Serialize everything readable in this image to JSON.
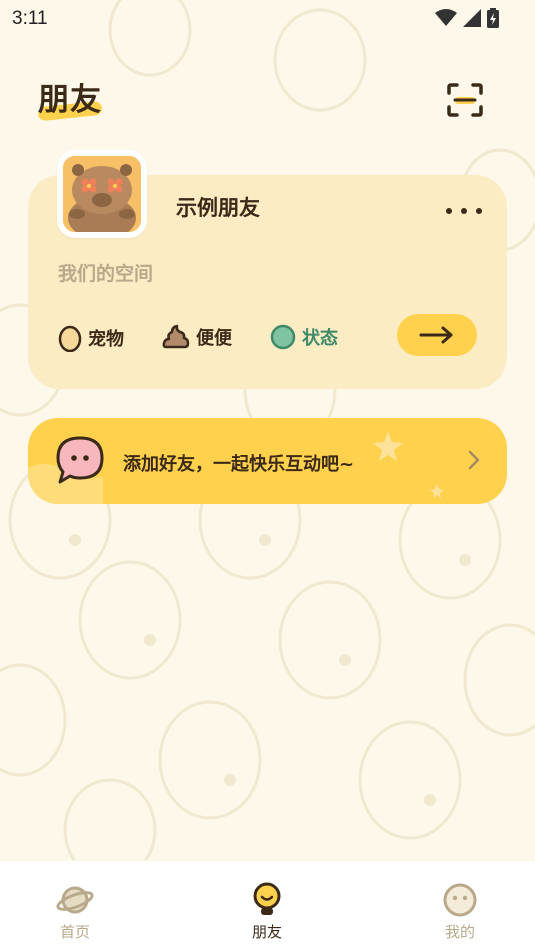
{
  "status_bar": {
    "time": "3:11"
  },
  "header": {
    "title": "朋友"
  },
  "friend_card": {
    "name": "示例朋友",
    "space_label": "我们的空间",
    "stats": [
      {
        "label": "宠物",
        "icon": "egg-icon"
      },
      {
        "label": "便便",
        "icon": "poop-icon"
      },
      {
        "label": "状态",
        "icon": "status-dot-icon"
      }
    ]
  },
  "add_friend_banner": {
    "text": "添加好友，一起快乐互动吧~"
  },
  "tab_bar": {
    "tabs": [
      {
        "label": "首页",
        "icon": "planet-icon",
        "active": false
      },
      {
        "label": "朋友",
        "icon": "friend-bulb-icon",
        "active": true
      },
      {
        "label": "我的",
        "icon": "face-icon",
        "active": false
      }
    ]
  },
  "colors": {
    "background": "#fdf8ea",
    "card": "#fbecc4",
    "accent_yellow": "#ffd14d",
    "text_dark": "#3b2a18",
    "text_muted": "#b8a98b",
    "status_green": "#3e8a69"
  }
}
